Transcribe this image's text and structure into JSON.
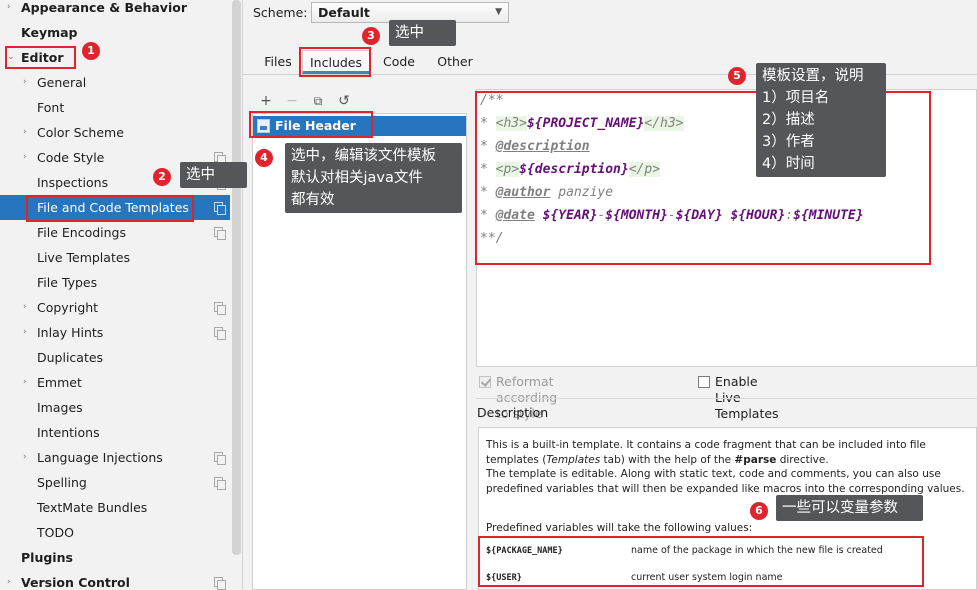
{
  "sidebar": {
    "items": [
      {
        "label": "Appearance & Behavior",
        "arrow": "›",
        "bold": true,
        "level": 0,
        "copy": false
      },
      {
        "label": "Keymap",
        "arrow": "",
        "bold": true,
        "level": 0,
        "copy": false
      },
      {
        "label": "Editor",
        "arrow": "⌄",
        "bold": true,
        "level": 0,
        "copy": false
      },
      {
        "label": "General",
        "arrow": "›",
        "bold": false,
        "level": 1,
        "copy": false
      },
      {
        "label": "Font",
        "arrow": "",
        "bold": false,
        "level": 1,
        "copy": false
      },
      {
        "label": "Color Scheme",
        "arrow": "›",
        "bold": false,
        "level": 1,
        "copy": false
      },
      {
        "label": "Code Style",
        "arrow": "›",
        "bold": false,
        "level": 1,
        "copy": true
      },
      {
        "label": "Inspections",
        "arrow": "",
        "bold": false,
        "level": 1,
        "copy": true
      },
      {
        "label": "File and Code Templates",
        "arrow": "",
        "bold": false,
        "level": 1,
        "copy": true,
        "selected": true
      },
      {
        "label": "File Encodings",
        "arrow": "",
        "bold": false,
        "level": 1,
        "copy": true
      },
      {
        "label": "Live Templates",
        "arrow": "",
        "bold": false,
        "level": 1,
        "copy": false
      },
      {
        "label": "File Types",
        "arrow": "",
        "bold": false,
        "level": 1,
        "copy": false
      },
      {
        "label": "Copyright",
        "arrow": "›",
        "bold": false,
        "level": 1,
        "copy": true
      },
      {
        "label": "Inlay Hints",
        "arrow": "›",
        "bold": false,
        "level": 1,
        "copy": true
      },
      {
        "label": "Duplicates",
        "arrow": "",
        "bold": false,
        "level": 1,
        "copy": false
      },
      {
        "label": "Emmet",
        "arrow": "›",
        "bold": false,
        "level": 1,
        "copy": false
      },
      {
        "label": "Images",
        "arrow": "",
        "bold": false,
        "level": 1,
        "copy": false
      },
      {
        "label": "Intentions",
        "arrow": "",
        "bold": false,
        "level": 1,
        "copy": false
      },
      {
        "label": "Language Injections",
        "arrow": "›",
        "bold": false,
        "level": 1,
        "copy": true
      },
      {
        "label": "Spelling",
        "arrow": "",
        "bold": false,
        "level": 1,
        "copy": true
      },
      {
        "label": "TextMate Bundles",
        "arrow": "",
        "bold": false,
        "level": 1,
        "copy": false
      },
      {
        "label": "TODO",
        "arrow": "",
        "bold": false,
        "level": 1,
        "copy": false
      },
      {
        "label": "Plugins",
        "arrow": "",
        "bold": true,
        "level": 0,
        "copy": false
      },
      {
        "label": "Version Control",
        "arrow": "›",
        "bold": true,
        "level": 0,
        "copy": true
      }
    ]
  },
  "scheme": {
    "label": "Scheme:",
    "value": "Default"
  },
  "tabs": [
    {
      "label": "Files",
      "active": false
    },
    {
      "label": "Includes",
      "active": true
    },
    {
      "label": "Code",
      "active": false
    },
    {
      "label": "Other",
      "active": false
    }
  ],
  "list_toolbar": {
    "add": "+",
    "remove": "−",
    "copy": "⧉",
    "reset": "↺"
  },
  "template_list": {
    "selected_item": "File Header"
  },
  "editor": {
    "line1": "/**",
    "line2": {
      "star": "* ",
      "open_tag": "<h3>",
      "var": "${PROJECT_NAME}",
      "close_tag": "</h3>"
    },
    "line3": {
      "star": "* ",
      "tag": "@description"
    },
    "line4": {
      "star": "* ",
      "open_tag": "<p>",
      "var": "${description}",
      "close_tag": "</p>"
    },
    "line5": {
      "star": "* ",
      "tag": "@author",
      "value": " panziye"
    },
    "line6": {
      "star": "* ",
      "tag": "@date",
      "v1": "${YEAR}",
      "s1": "-",
      "v2": "${MONTH}",
      "s2": "-",
      "v3": "${DAY}",
      "s3": " ",
      "v4": "${HOUR}",
      "s4": ":",
      "v5": "${MINUTE}"
    },
    "line7": "**/"
  },
  "options": {
    "reformat": "Reformat according to style",
    "live_templates": "Enable Live Templates"
  },
  "description": {
    "title": "Description",
    "text1_a": "This is a built-in template. It contains a code fragment that can be included into file templates (",
    "text1_b": "Templates",
    "text1_c": " tab) with the help of the ",
    "text1_d": "#parse",
    "text1_e": " directive.",
    "text2": "The template is editable. Along with static text, code and comments, you can also use predefined variables that will then be expanded like macros into the corresponding values.",
    "predefined": "Predefined variables will take the following values:",
    "variables": [
      {
        "name": "${PACKAGE_NAME}",
        "desc": "name of the package in which the new file is created"
      },
      {
        "name": "${USER}",
        "desc": "current user system login name"
      }
    ]
  },
  "annotations": [
    {
      "number": "1",
      "text": ""
    },
    {
      "number": "2",
      "text": "选中"
    },
    {
      "number": "3",
      "text": "选中"
    },
    {
      "number": "4",
      "lines": [
        "选中，编辑该文件模板",
        "默认对相关java文件",
        "都有效"
      ]
    },
    {
      "number": "5",
      "lines": [
        "模板设置，说明",
        "1）项目名",
        "2）描述",
        "3）作者",
        "4）时间"
      ]
    },
    {
      "number": "6",
      "text": "一些可以变量参数"
    }
  ],
  "colors": {
    "selection": "#2675bf",
    "annotation_red": "#e0242e",
    "callout_bg": "#555659"
  }
}
